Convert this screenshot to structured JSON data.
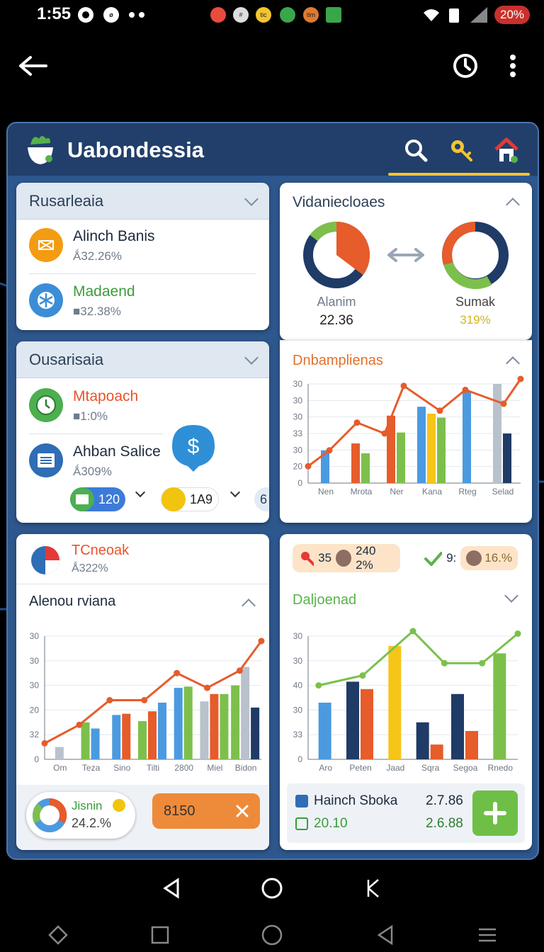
{
  "status_bar": {
    "time": "1:55",
    "notif_badges": [
      "tic",
      "tim"
    ],
    "battery": "20%"
  },
  "app_header": {
    "title": "Uabondessia"
  },
  "card_accounts_1": {
    "title": "Rusarleaia",
    "items": [
      {
        "name": "Alinch Banis",
        "sub": "Ǻ32.26%",
        "icon": "layers-icon"
      },
      {
        "name": "Madaend",
        "sub": "■32.38%",
        "icon": "snowflake-icon"
      }
    ]
  },
  "card_accounts_2": {
    "title": "Ousarisaia",
    "items": [
      {
        "name": "Mtapoach",
        "sub": "■1:0%",
        "icon": "timer-icon"
      },
      {
        "name": "Ahban Salice",
        "sub": "Ǻ309%",
        "icon": "list-icon"
      }
    ],
    "pills": [
      {
        "label": "120",
        "color": "#3d7bd8"
      },
      {
        "label": "1A9",
        "color": "#f1c40f"
      },
      {
        "label": "6",
        "color": "#e1ebf5"
      }
    ]
  },
  "card_donuts": {
    "title": "Vidaniecloaes",
    "left": {
      "label": "Alanim",
      "value": "22.36"
    },
    "right": {
      "label": "Sumak",
      "value": "319%"
    }
  },
  "card_chart_1": {
    "title": "Dnbamplienas",
    "chart_data": {
      "type": "bar",
      "categories": [
        "Nen",
        "Mrota",
        "Ner",
        "Kana",
        "Rteg",
        "Selad"
      ],
      "y_tick_labels": [
        "30",
        "30",
        "30",
        "33",
        "30",
        "20",
        "0"
      ]
    }
  },
  "card_summary": {
    "title": "TCneoak",
    "sub": "Ǻ322%"
  },
  "card_chart_2": {
    "title": "Alenou rviana",
    "chart_data": {
      "type": "bar",
      "categories": [
        "Om",
        "Teza",
        "Sino",
        "Tilti",
        "2800",
        "Miel",
        "Bidon"
      ],
      "y_tick_labels": [
        "30",
        "30",
        "30",
        "20",
        "32",
        "0"
      ]
    },
    "donut_pill": {
      "label": "Jisnin",
      "value": "24.2.%"
    },
    "action_pill": {
      "label": "8150"
    }
  },
  "card_chart_3": {
    "badges": [
      {
        "prefix": "35",
        "value": "240 2%"
      },
      {
        "prefix": "9:",
        "value": "16.%"
      }
    ],
    "title": "Daljoenad",
    "chart_data": {
      "type": "bar",
      "categories": [
        "Aro",
        "Peten",
        "Jaad",
        "Sqra",
        "Segoa",
        "Rnedo"
      ],
      "y_tick_labels": [
        "30",
        "30",
        "40",
        "30",
        "33",
        "0"
      ]
    },
    "footer": {
      "row1": {
        "label": "Hainch Sboka",
        "value": "2.7.86"
      },
      "row2": {
        "label": "20.10",
        "value": "2.6.88"
      }
    }
  },
  "colors": {
    "blue": "#4b9ae0",
    "navy": "#1f3b66",
    "orange": "#e65c2b",
    "green": "#7cc04b",
    "yellow": "#f5c518",
    "gray": "#b9c2cc"
  }
}
